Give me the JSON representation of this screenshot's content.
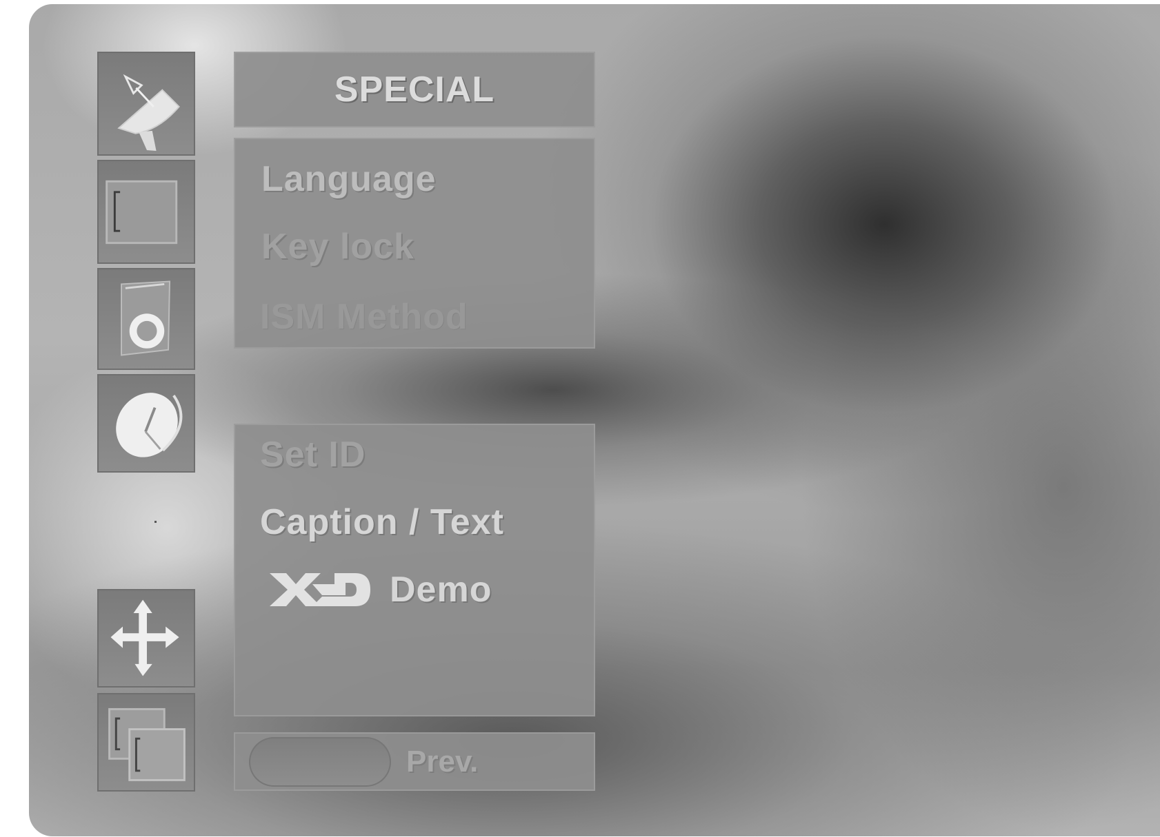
{
  "menu": {
    "title": "SPECIAL",
    "group1": {
      "items": [
        "Language",
        "Key lock",
        "ISM Method"
      ]
    },
    "group2": {
      "items": [
        "Set ID",
        "Caption / Text",
        "Demo"
      ],
      "demo_logo": "XD"
    }
  },
  "footer": {
    "prev_label": "Prev."
  },
  "sidebar": {
    "icons": [
      "satellite-dish-icon",
      "screen-picture-icon",
      "speaker-sound-icon",
      "clock-time-icon",
      "move-arrows-icon",
      "pip-windows-icon"
    ]
  },
  "colors": {
    "panel": "#8e8e8e",
    "text_highlight": "#d6d6d6",
    "text_dim": "#a1a1a1",
    "background": "#a9a9a9"
  }
}
